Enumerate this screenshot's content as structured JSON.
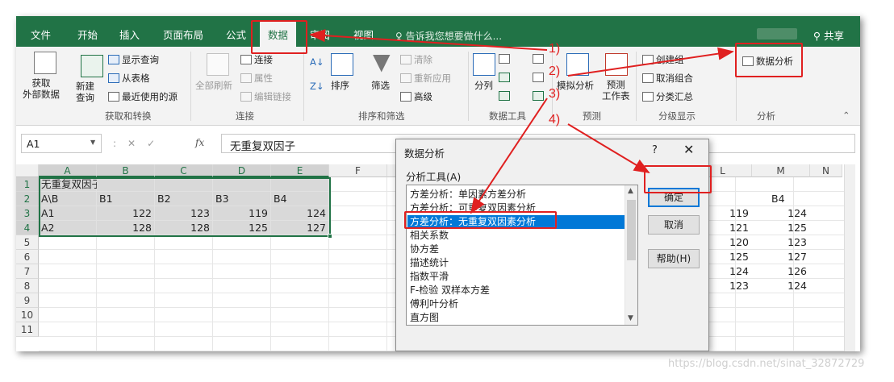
{
  "ribbon_tabs": [
    "文件",
    "开始",
    "插入",
    "页面布局",
    "公式",
    "数据",
    "审阅",
    "视图"
  ],
  "active_tab": "数据",
  "tell_me": "告诉我您想要做什么...",
  "share": "共享",
  "ribbon": {
    "get_external": "获取\n外部数据",
    "new_query": "新建\n查询",
    "show_query": "显示查询",
    "from_table": "从表格",
    "recent_sources": "最近使用的源",
    "group_get_transform": "获取和转换",
    "refresh_all": "全部刷新",
    "connections": "连接",
    "properties": "属性",
    "edit_links": "编辑链接",
    "group_connections": "连接",
    "sort": "排序",
    "filter": "筛选",
    "clear": "清除",
    "reapply": "重新应用",
    "advanced": "高级",
    "group_sort_filter": "排序和筛选",
    "split": "分列",
    "group_data_tools": "数据工具",
    "what_if": "模拟分析",
    "forecast_sheet": "预测\n工作表",
    "group_forecast": "预测",
    "group_create": "创建组",
    "ungroup": "取消组合",
    "subtotal": "分类汇总",
    "group_outline": "分级显示",
    "data_analysis": "数据分析",
    "group_analysis": "分析"
  },
  "formula_bar": {
    "name_box": "A1",
    "fx": "fx",
    "content": "无重复双因子"
  },
  "columns": [
    "A",
    "B",
    "C",
    "D",
    "E",
    "F"
  ],
  "right_columns": [
    "L",
    "M",
    "N"
  ],
  "rows": [
    "1",
    "2",
    "3",
    "4",
    "5",
    "6",
    "7",
    "8",
    "9",
    "10",
    "11"
  ],
  "cells": {
    "A1": "无重复双因子",
    "A2": "A\\B",
    "B2": "B1",
    "C2": "B2",
    "D2": "B3",
    "E2": "B4",
    "A3": "A1",
    "B3": "122",
    "C3": "123",
    "D3": "119",
    "E3": "124",
    "A4": "A2",
    "B4": "128",
    "C4": "128",
    "D4": "125",
    "E4": "127"
  },
  "right_cells": {
    "M2": "B4",
    "L": [
      "119",
      "121",
      "120",
      "125",
      "124",
      "123"
    ],
    "M": [
      "124",
      "125",
      "123",
      "127",
      "126",
      "124"
    ]
  },
  "dialog": {
    "title": "数据分析",
    "help": "?",
    "close": "✕",
    "tools_label": "分析工具(A)",
    "items": [
      "方差分析：单因素方差分析",
      "方差分析：可重复双因素分析",
      "方差分析：无重复双因素分析",
      "相关系数",
      "协方差",
      "描述统计",
      "指数平滑",
      "F-检验 双样本方差",
      "傅利叶分析",
      "直方图"
    ],
    "selected_index": 2,
    "ok": "确定",
    "cancel": "取消",
    "help_button": "帮助(H)"
  },
  "annotations": [
    "1)",
    "2)",
    "3)",
    "4)"
  ],
  "watermark": "https://blog.csdn.net/sinat_32872729",
  "colors": {
    "excel_green": "#217346",
    "annotation_red": "#e02020",
    "selection_blue": "#0078d7"
  }
}
